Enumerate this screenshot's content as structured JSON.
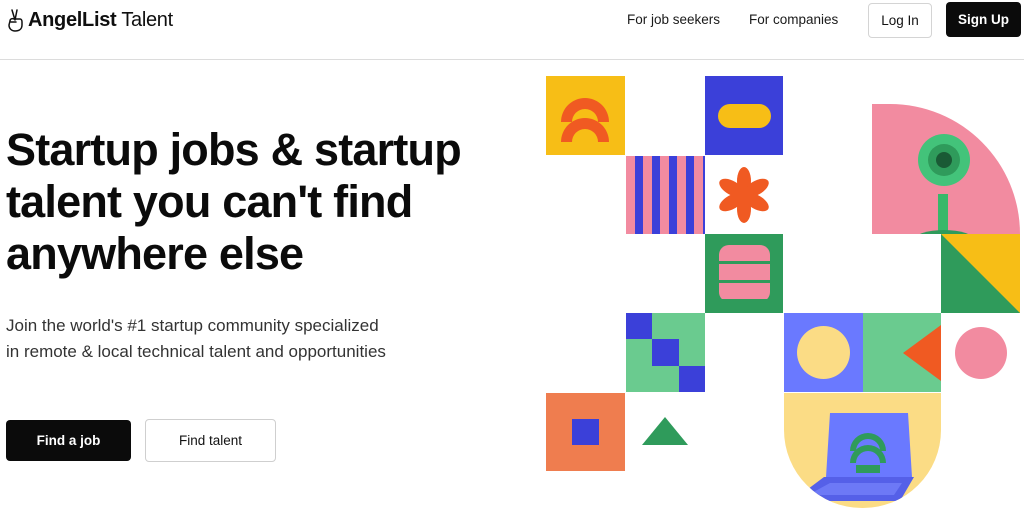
{
  "header": {
    "logo_strong": "AngelList",
    "logo_light": " Talent",
    "nav": {
      "job_seekers": "For job seekers",
      "companies": "For companies"
    },
    "login_label": "Log In",
    "signup_label": "Sign Up"
  },
  "hero": {
    "title": "Startup jobs & startup talent you can't find anywhere else",
    "subtitle": "Join the world's #1 startup community specialized in remote & local technical talent and opportunities",
    "find_job_label": "Find a job",
    "find_talent_label": "Find talent"
  },
  "colors": {
    "yellow": "#f7be16",
    "orange": "#f05a22",
    "blue": "#3b40d9",
    "pink": "#f28ba0",
    "green": "#2f9b5b",
    "mint": "#6acb8f",
    "periwinkle": "#6a79ff",
    "sand": "#fbdc85",
    "coral": "#ef7d4f",
    "dark": "#0b0b0b"
  }
}
